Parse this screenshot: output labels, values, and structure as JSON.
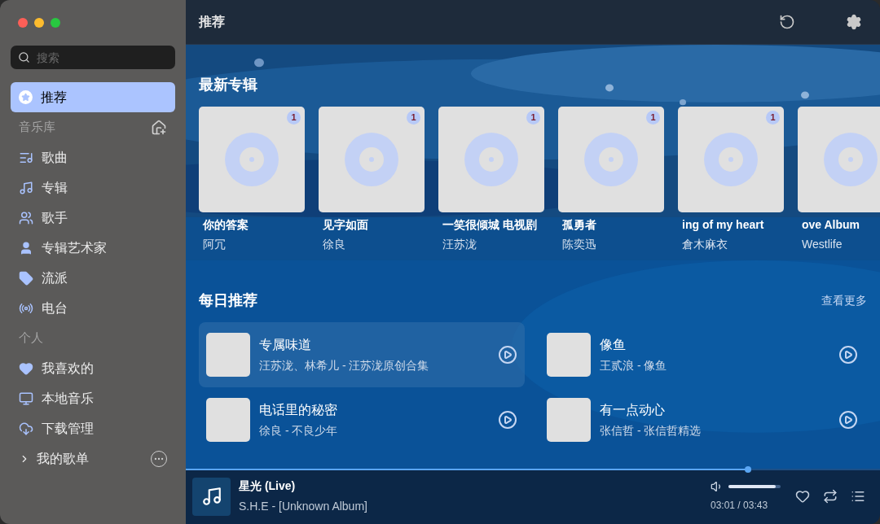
{
  "window": {
    "title": "推荐"
  },
  "search": {
    "placeholder": "搜索"
  },
  "sidebar": {
    "items": [
      {
        "kind": "item",
        "label": "推荐",
        "selected": true
      },
      {
        "kind": "section",
        "label": "音乐库"
      },
      {
        "kind": "item",
        "label": "歌曲",
        "selected": false
      },
      {
        "kind": "item",
        "label": "专辑",
        "selected": false
      },
      {
        "kind": "item",
        "label": "歌手",
        "selected": false
      },
      {
        "kind": "item",
        "label": "专辑艺术家",
        "selected": false
      },
      {
        "kind": "item",
        "label": "流派",
        "selected": false
      },
      {
        "kind": "item",
        "label": "电台",
        "selected": false
      },
      {
        "kind": "section",
        "label": "个人"
      },
      {
        "kind": "item",
        "label": "我喜欢的",
        "selected": false
      },
      {
        "kind": "item",
        "label": "本地音乐",
        "selected": false
      },
      {
        "kind": "item",
        "label": "下载管理",
        "selected": false
      },
      {
        "kind": "group",
        "label": "我的歌单",
        "expanded": false
      }
    ]
  },
  "latest_albums": {
    "title": "最新专辑",
    "albums": [
      {
        "title": "你的答案",
        "artist": "阿冗",
        "badge": "1"
      },
      {
        "title": "见字如面",
        "artist": "徐良",
        "badge": "1"
      },
      {
        "title": "一笑很倾城 电视剧",
        "artist": "汪苏泷",
        "badge": "1"
      },
      {
        "title": "孤勇者",
        "artist": "陈奕迅",
        "badge": "1"
      },
      {
        "title": "ing of my heart",
        "artist": "倉木麻衣",
        "badge": "1"
      },
      {
        "title": "ove Album",
        "artist": "Westlife"
      }
    ]
  },
  "daily": {
    "title": "每日推荐",
    "more": "查看更多",
    "songs": [
      {
        "title": "专属味道",
        "subtitle": "汪苏泷、林希儿 - 汪苏泷原创合集",
        "selected": true
      },
      {
        "title": "像鱼",
        "subtitle": "王贰浪 - 像鱼",
        "selected": false
      },
      {
        "title": "电话里的秘密",
        "subtitle": "徐良 - 不良少年",
        "selected": false
      },
      {
        "title": "有一点动心",
        "subtitle": "张信哲 - 张信哲精选",
        "selected": false
      }
    ]
  },
  "player": {
    "title": "星光 (Live)",
    "subtitle": "S.H.E - [Unknown Album]",
    "progress": {
      "level": 0.81
    },
    "volume": {
      "level": 0.9
    },
    "time": "03:01 / 03:43"
  }
}
